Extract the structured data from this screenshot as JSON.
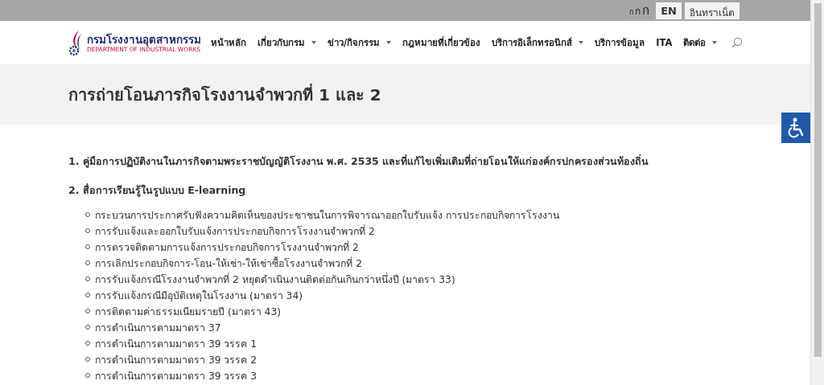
{
  "top_bar": {
    "font_size_buttons": [
      "ก",
      "ก",
      "ก"
    ],
    "buttons": [
      "EN",
      "อินทราเน็ต"
    ]
  },
  "header": {
    "logo": {
      "title": "กรมโรงงานอุตสาหกรรม",
      "subtitle": "DEPARTMENT OF INDUSTRIAL WORKS"
    },
    "nav": [
      {
        "label": "หน้าหลัก",
        "has_dropdown": false
      },
      {
        "label": "เกี่ยวกับกรม",
        "has_dropdown": true
      },
      {
        "label": "ข่าว/กิจกรรม",
        "has_dropdown": true
      },
      {
        "label": "กฎหมายที่เกี่ยวข้อง",
        "has_dropdown": false
      },
      {
        "label": "บริการอิเล็กทรอนิกส์",
        "has_dropdown": true
      },
      {
        "label": "บริการข้อมูล",
        "has_dropdown": false
      },
      {
        "label": "ITA",
        "has_dropdown": false
      },
      {
        "label": "ติดต่อ",
        "has_dropdown": true
      }
    ]
  },
  "page_title": "การถ่ายโอนภารกิจโรงงานจำพวกที่ 1 และ 2",
  "sections": [
    {
      "heading": "1. คู่มือการปฏิบัติงานในภารกิจตามพระราชบัญญัติโรงงาน พ.ศ. 2535 และที่แก้ไขเพิ่มเติมที่ถ่ายโอนให้แก่องค์กรปกครองส่วนท้องถิ่น"
    },
    {
      "heading": "2. สื่อการเรียนรู้ในรูปแบบ E-learning",
      "items": [
        "กระบวนการประกาศรับฟังความคิดเห็นของประชาชนในการพิจารณาออกใบรับแจ้ง การประกอบกิจการโรงงาน",
        "การรับแจ้งและออกใบรับแจ้งการประกอบกิจการโรงงานจำพวกที่ 2",
        "การตรวจติดตามการแจ้งการประกอบกิจการโรงงานจำพวกที่ 2",
        "การเลิกประกอบกิจการ-โอน-ให้เช่า-ให้เช่าซื้อโรงงานจำพวกที่ 2",
        "การรับแจ้งกรณีโรงงานจำพวกที่ 2 หยุดดำเนินงานติดต่อกันเกินกว่าหนึ่งปี (มาตรา 33)",
        "การรับแจ้งกรณีมีอุบัติเหตุในโรงงาน (มาตรา 34)",
        "การติดตามค่าธรรมเนียมรายปี (มาตรา 43)",
        "การดำเนินการตามมาตรา 37",
        "การดำเนินการตามมาตรา 39 วรรค 1",
        "การดำเนินการตามมาตรา 39 วรรค 2",
        "การดำเนินการตามมาตรา 39 วรรค 3"
      ]
    }
  ]
}
